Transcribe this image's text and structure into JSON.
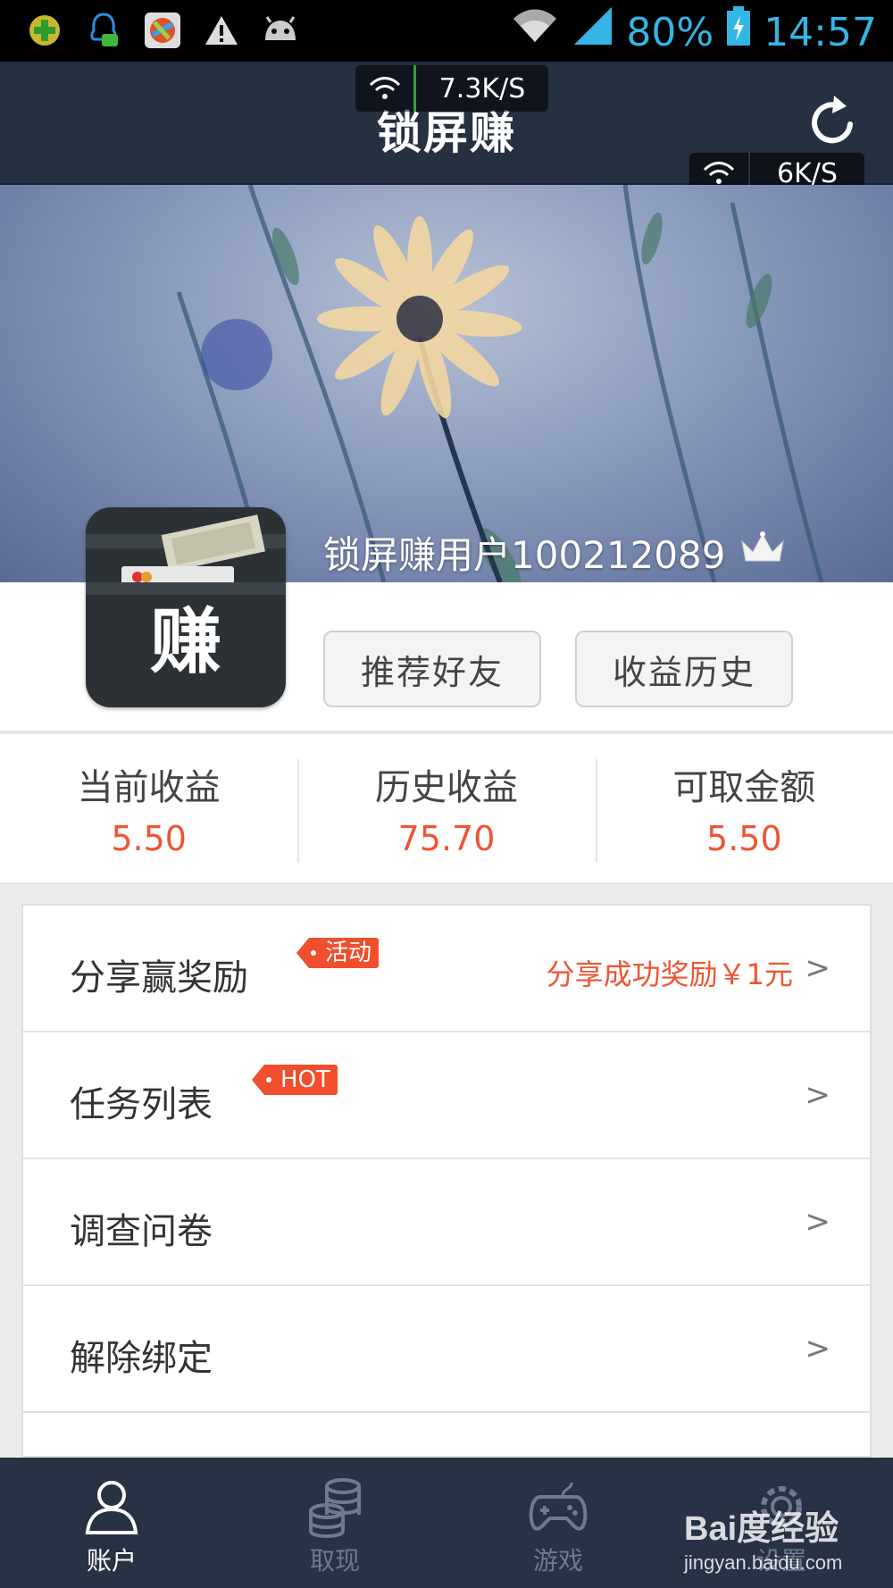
{
  "status_bar": {
    "battery": "80%",
    "time": "14:57",
    "icons": [
      "plus-badge-icon",
      "qq-message-icon",
      "app-grid-icon",
      "warning-icon",
      "android-icon",
      "wifi-icon",
      "signal-icon",
      "battery-icon"
    ]
  },
  "header": {
    "title": "锁屏赚",
    "speed_overlay_1": "7.3K/S",
    "speed_overlay_2": "6K/S",
    "refresh_icon": "refresh-icon"
  },
  "profile": {
    "username": "锁屏赚用户100212089",
    "avatar_char": "赚",
    "crown_icon": "crown-icon",
    "buttons": {
      "recommend": "推荐好友",
      "history": "收益历史"
    }
  },
  "stats": [
    {
      "label": "当前收益",
      "value": "5.50"
    },
    {
      "label": "历史收益",
      "value": "75.70"
    },
    {
      "label": "可取金额",
      "value": "5.50"
    }
  ],
  "menu": [
    {
      "label": "分享赢奖励",
      "tag": "活动",
      "note": "分享成功奖励￥1元",
      "chevron": ">"
    },
    {
      "label": "任务列表",
      "tag": "HOT",
      "note": "",
      "chevron": ">"
    },
    {
      "label": "调查问卷",
      "tag": "",
      "note": "",
      "chevron": ">"
    },
    {
      "label": "解除绑定",
      "tag": "",
      "note": "",
      "chevron": ">"
    }
  ],
  "bottom_nav": [
    {
      "label": "账户",
      "icon": "user-icon",
      "active": true
    },
    {
      "label": "取现",
      "icon": "coins-icon",
      "active": false
    },
    {
      "label": "游戏",
      "icon": "gamepad-icon",
      "active": false
    },
    {
      "label": "设置",
      "icon": "gear-icon",
      "active": false
    }
  ],
  "watermark": {
    "logo": "Bai度经验",
    "url": "jingyan.baidu.com"
  },
  "colors": {
    "header_bg": "#253041",
    "accent_red": "#ee5533",
    "tag_red": "#f04e2c",
    "status_blue": "#33b5e5"
  }
}
